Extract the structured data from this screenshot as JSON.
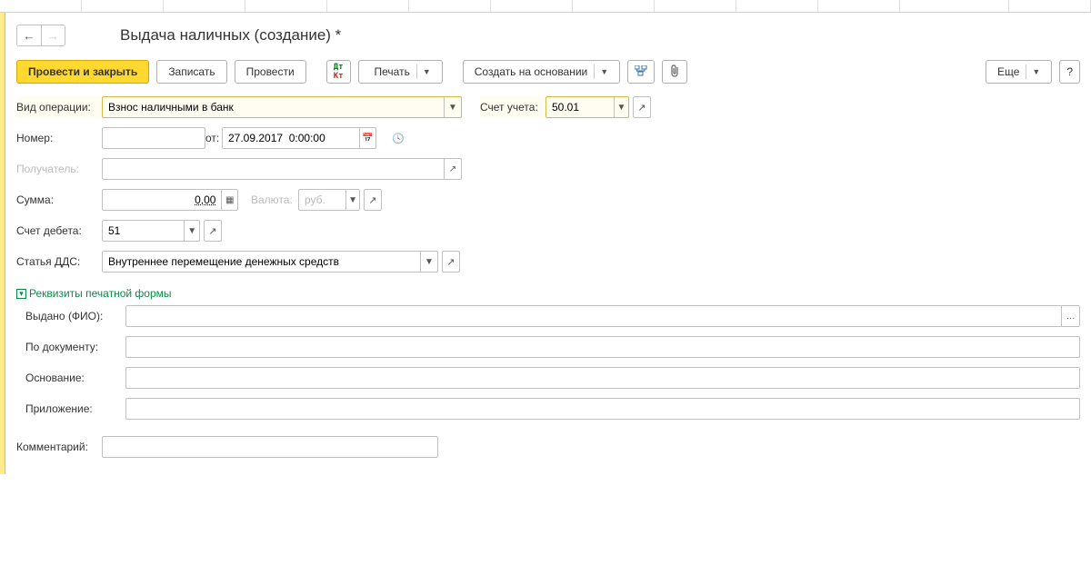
{
  "title": "Выдача наличных (создание) *",
  "toolbar": {
    "post_close": "Провести и закрыть",
    "write": "Записать",
    "post": "Провести",
    "print": "Печать",
    "create_based": "Создать на основании",
    "more": "Еще"
  },
  "operation": {
    "label": "Вид операции:",
    "value": "Взнос наличными в банк"
  },
  "account": {
    "label": "Счет учета:",
    "value": "50.01"
  },
  "number": {
    "label": "Номер:",
    "from_label": "от:",
    "date_value": "27.09.2017  0:00:00"
  },
  "recipient": {
    "label": "Получатель:"
  },
  "sum": {
    "label": "Сумма:",
    "value": "0,00",
    "currency_label": "Валюта:",
    "currency_value": "руб."
  },
  "debit_account": {
    "label": "Счет дебета:",
    "value": "51"
  },
  "dds": {
    "label": "Статья ДДС:",
    "value": "Внутреннее перемещение денежных средств"
  },
  "print_section": {
    "header": "Реквизиты печатной формы",
    "issued_label": "Выдано (ФИО):",
    "document_label": "По документу:",
    "basis_label": "Основание:",
    "appendix_label": "Приложение:"
  },
  "comment": {
    "label": "Комментарий:"
  }
}
